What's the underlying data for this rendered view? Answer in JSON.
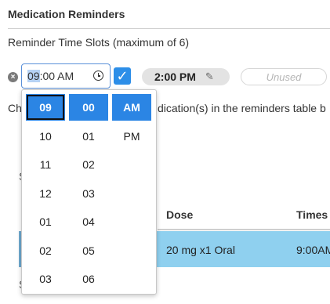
{
  "section": {
    "title": "Medication Reminders",
    "slots_label": "Reminder Time Slots (maximum of 6)"
  },
  "time_slot_1": {
    "input_hour": "09",
    "input_rest": ":00 AM",
    "enabled": true
  },
  "time_slot_2": {
    "time": "2:00 PM"
  },
  "time_slot_3": {
    "placeholder": "Unused"
  },
  "behind_text": {
    "left": "Ch",
    "right": "dication(s) in the reminders table b"
  },
  "table": {
    "headers": {
      "dose": "Dose",
      "times": "Times"
    },
    "selected_row": {
      "dose": "20 mg x1 Oral",
      "times": "9:00AM"
    },
    "faint_left_1": "S",
    "faint_left_2": "S"
  },
  "picker": {
    "hours": [
      "09",
      "10",
      "11",
      "12",
      "01",
      "02",
      "03"
    ],
    "minutes": [
      "00",
      "01",
      "02",
      "03",
      "04",
      "05",
      "06"
    ],
    "periods": [
      "AM",
      "PM"
    ],
    "selected": {
      "hour": "09",
      "minute": "00",
      "period": "AM"
    }
  },
  "colors": {
    "accent": "#2b85e4",
    "selected_row": "#8fd0ef"
  },
  "icons": {
    "remove": "remove-circle-icon",
    "clock": "clock-icon",
    "checkbox": "checkmark-icon",
    "edit": "pencil-icon"
  }
}
